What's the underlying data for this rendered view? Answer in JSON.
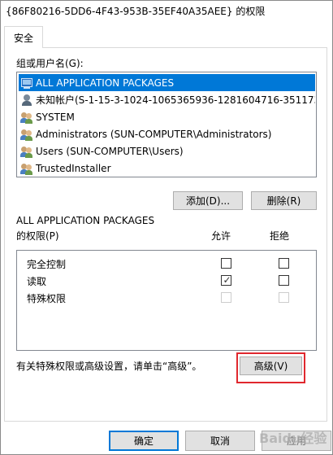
{
  "window": {
    "title": "{86F80216-5DD6-4F43-953B-35EF40A35AEE} 的权限"
  },
  "tabs": [
    {
      "label": "安全",
      "active": true
    }
  ],
  "groups": {
    "label": "组或用户名(G):",
    "items": [
      {
        "label": "ALL APPLICATION PACKAGES",
        "icon": "package-icon",
        "selected": true
      },
      {
        "label": "未知帐户(S-1-15-3-1024-1065365936-1281604716-351173...",
        "icon": "unknown-account-icon",
        "selected": false
      },
      {
        "label": "SYSTEM",
        "icon": "users-icon",
        "selected": false
      },
      {
        "label": "Administrators (SUN-COMPUTER\\Administrators)",
        "icon": "users-icon",
        "selected": false
      },
      {
        "label": "Users (SUN-COMPUTER\\Users)",
        "icon": "users-icon",
        "selected": false
      },
      {
        "label": "TrustedInstaller",
        "icon": "users-icon",
        "selected": false
      }
    ],
    "add_button": "添加(D)...",
    "remove_button": "删除(R)"
  },
  "permissions": {
    "subject_line": "ALL APPLICATION PACKAGES",
    "label": "的权限(P)",
    "allow_header": "允许",
    "deny_header": "拒绝",
    "rows": [
      {
        "name": "完全控制",
        "allow": false,
        "deny": false,
        "disabled": false
      },
      {
        "name": "读取",
        "allow": true,
        "deny": false,
        "disabled": false
      },
      {
        "name": "特殊权限",
        "allow": false,
        "deny": false,
        "disabled": true
      }
    ]
  },
  "advanced": {
    "hint": "有关特殊权限或高级设置，请单击“高级”。",
    "button": "高级(V)"
  },
  "footer": {
    "ok": "确定",
    "cancel": "取消",
    "apply": "应用"
  },
  "watermark": "Baidu经验",
  "colors": {
    "selection": "#0078d7",
    "highlight_box": "#e0282e",
    "button_face": "#e1e1e1"
  }
}
